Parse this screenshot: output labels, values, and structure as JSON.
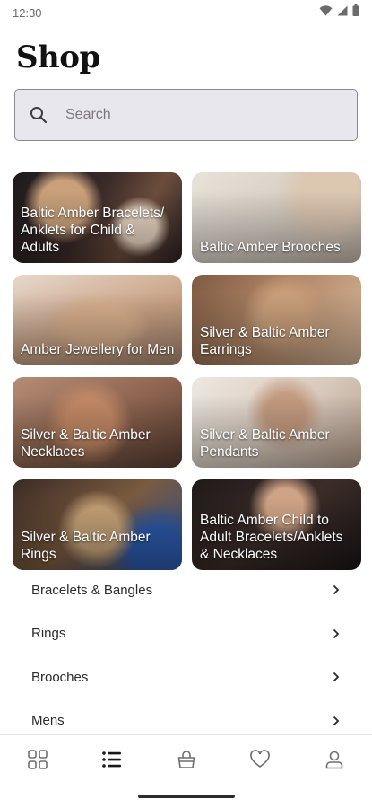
{
  "status_bar": {
    "time": "12:30",
    "icons": [
      "wifi-icon",
      "signal-icon",
      "battery-icon"
    ]
  },
  "page": {
    "title": "Shop"
  },
  "search": {
    "placeholder": "Search",
    "value": ""
  },
  "categories": [
    {
      "label": "Baltic Amber Bracelets/ Anklets for Child & Adults"
    },
    {
      "label": "Baltic Amber Brooches"
    },
    {
      "label": "Amber Jewellery for Men"
    },
    {
      "label": "Silver & Baltic Amber Earrings"
    },
    {
      "label": "Silver & Baltic Amber Necklaces"
    },
    {
      "label": "Silver & Baltic Amber Pendants"
    },
    {
      "label": "Silver & Baltic Amber Rings"
    },
    {
      "label": "Baltic Amber Child to Adult Bracelets/Anklets & Necklaces"
    }
  ],
  "list": [
    {
      "label": "Bracelets & Bangles",
      "icon": "chevron-right-icon"
    },
    {
      "label": "Rings",
      "icon": "chevron-right-icon"
    },
    {
      "label": "Brooches",
      "icon": "chevron-right-icon"
    },
    {
      "label": "Mens",
      "icon": "chevron-right-icon"
    }
  ],
  "bottom_nav": {
    "items": [
      {
        "icon": "grid-icon",
        "active": false
      },
      {
        "icon": "list-icon",
        "active": true
      },
      {
        "icon": "bag-icon",
        "active": false
      },
      {
        "icon": "heart-icon",
        "active": false
      },
      {
        "icon": "profile-icon",
        "active": false
      }
    ]
  },
  "colors": {
    "search_bg": "#e9e7ee",
    "search_border": "#8a8790",
    "text_primary": "#111111",
    "icon_inactive": "#6f6f6f",
    "icon_active": "#1a1a1a"
  }
}
